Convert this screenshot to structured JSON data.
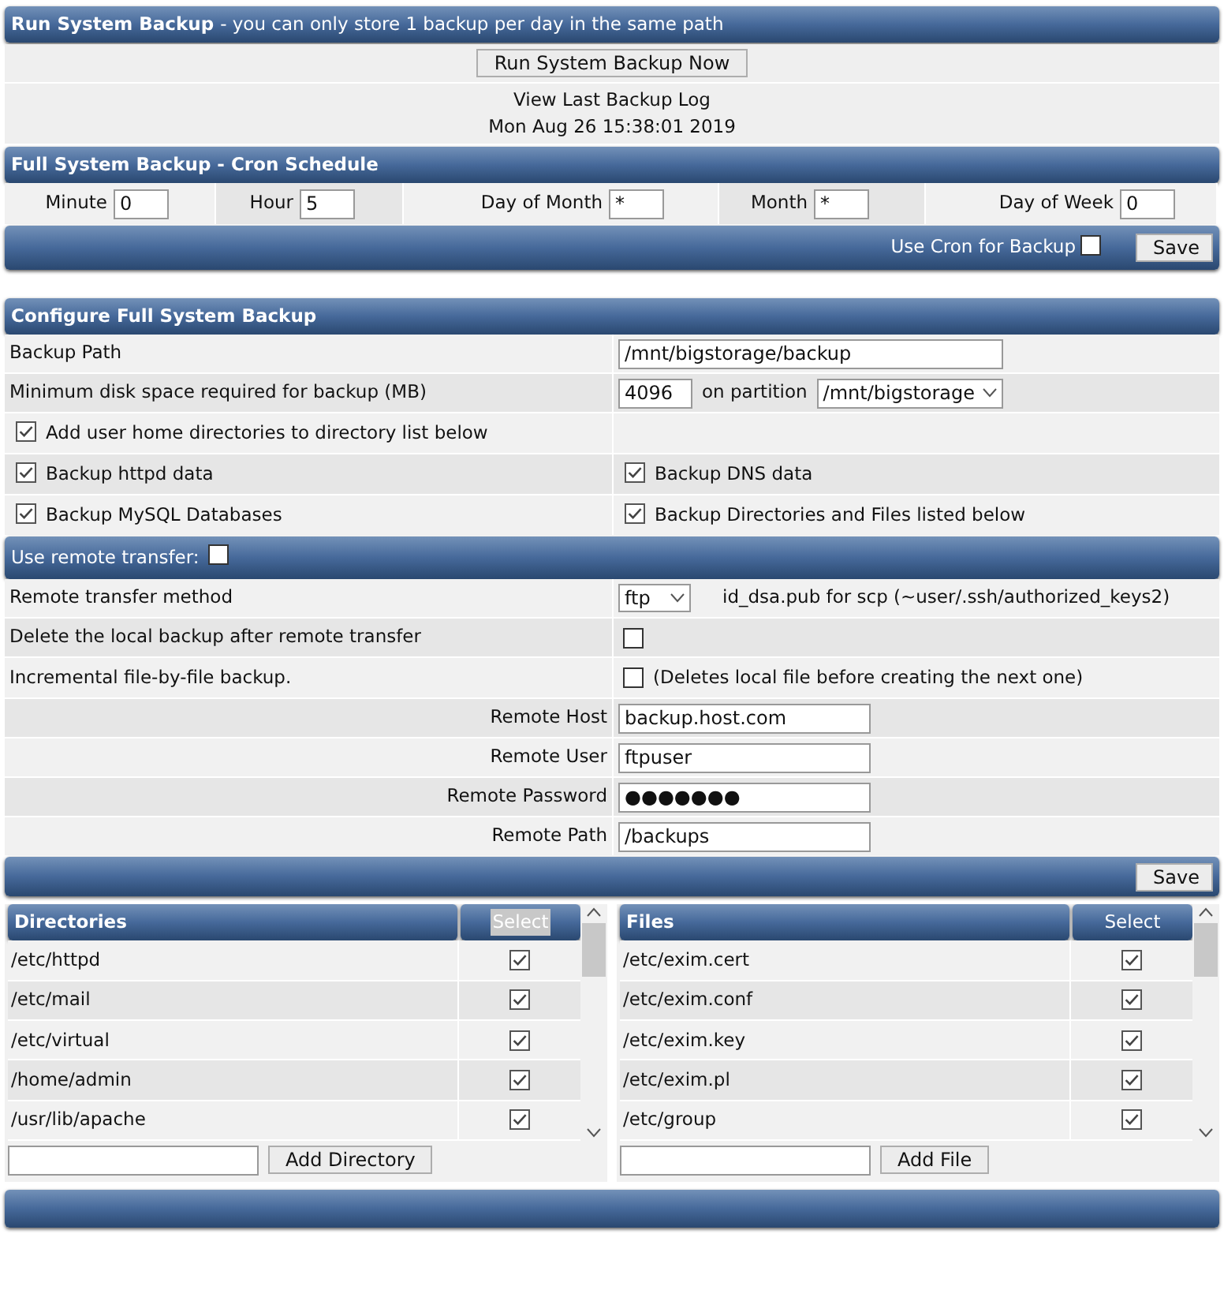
{
  "run_backup": {
    "title": "Run System Backup",
    "subtitle": "- you can only store 1 backup per day in the same path",
    "run_button": "Run System Backup Now",
    "log_link": "View Last Backup Log",
    "last_run": "Mon Aug 26 15:38:01 2019"
  },
  "cron": {
    "title": "Full System Backup - Cron Schedule",
    "fields": [
      {
        "label": "Minute",
        "value": "0"
      },
      {
        "label": "Hour",
        "value": "5"
      },
      {
        "label": "Day of Month",
        "value": "*"
      },
      {
        "label": "Month",
        "value": "*"
      },
      {
        "label": "Day of Week",
        "value": "0"
      }
    ],
    "use_cron": {
      "label": "Use Cron for Backup",
      "checked": false
    },
    "save_button": "Save"
  },
  "configure": {
    "title": "Configure Full System Backup",
    "backup_path": {
      "label": "Backup Path",
      "value": "/mnt/bigstorage/backup"
    },
    "min_space": {
      "label": "Minimum disk space required for backup (MB)",
      "value": "4096",
      "partition_label": "on partition",
      "partition": "/mnt/bigstorage"
    },
    "options": [
      {
        "label": "Add user home directories to directory list below",
        "checked": true
      },
      {
        "label": "Backup httpd data",
        "checked": true
      },
      {
        "label": "Backup DNS data",
        "checked": true
      },
      {
        "label": "Backup MySQL Databases",
        "checked": true
      },
      {
        "label": "Backup Directories and Files listed below",
        "checked": true
      }
    ]
  },
  "remote": {
    "label": "Use remote transfer:",
    "checked": false,
    "method": {
      "label": "Remote transfer method",
      "value": "ftp",
      "note": "id_dsa.pub for scp (~user/.ssh/authorized_keys2)"
    },
    "delete_local": {
      "label": "Delete the local backup after remote transfer",
      "checked": false
    },
    "incremental": {
      "label": "Incremental file-by-file backup.",
      "checked": false,
      "note": "(Deletes local file before creating the next one)"
    },
    "fields": [
      {
        "label": "Remote Host",
        "value": "backup.host.com"
      },
      {
        "label": "Remote User",
        "value": "ftpuser"
      },
      {
        "label": "Remote Password",
        "value": "●●●●●●●"
      },
      {
        "label": "Remote Path",
        "value": "/backups"
      }
    ],
    "save_button": "Save"
  },
  "lists": [
    {
      "title": "Directories",
      "select_label": "Select",
      "highlighted": true,
      "add_button": "Add Directory",
      "rows": [
        {
          "path": "/etc/httpd",
          "checked": true
        },
        {
          "path": "/etc/mail",
          "checked": true
        },
        {
          "path": "/etc/virtual",
          "checked": true
        },
        {
          "path": "/home/admin",
          "checked": true
        },
        {
          "path": "/usr/lib/apache",
          "checked": true
        }
      ]
    },
    {
      "title": "Files",
      "select_label": "Select",
      "highlighted": false,
      "add_button": "Add File",
      "rows": [
        {
          "path": "/etc/exim.cert",
          "checked": true
        },
        {
          "path": "/etc/exim.conf",
          "checked": true
        },
        {
          "path": "/etc/exim.key",
          "checked": true
        },
        {
          "path": "/etc/exim.pl",
          "checked": true
        },
        {
          "path": "/etc/group",
          "checked": true
        }
      ]
    }
  ]
}
